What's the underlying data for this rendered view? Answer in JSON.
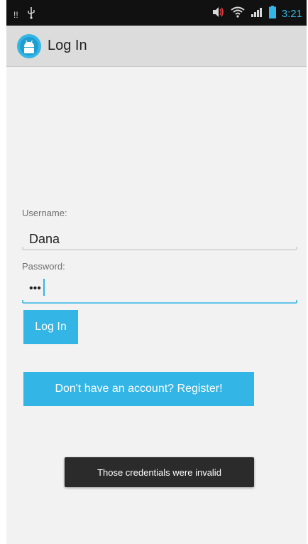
{
  "status_bar": {
    "notification_text": "!!",
    "time": "3:21",
    "icons": [
      "usb-icon",
      "volume-icon",
      "wifi-icon",
      "signal-icon",
      "battery-icon"
    ]
  },
  "action_bar": {
    "title": "Log In",
    "icon": "android-app-icon"
  },
  "form": {
    "username_label": "Username:",
    "username_value": "Dana",
    "password_label": "Password:",
    "password_value": "•••"
  },
  "buttons": {
    "login_label": "Log In",
    "register_label": "Don't have an account? Register!"
  },
  "toast": {
    "message": "Those credentials were invalid"
  },
  "colors": {
    "accent": "#33b5e5",
    "background": "#f2f2f2",
    "action_bar": "#dcdcdc",
    "status_bar": "#111111",
    "toast_bg": "#2b2b2b"
  }
}
